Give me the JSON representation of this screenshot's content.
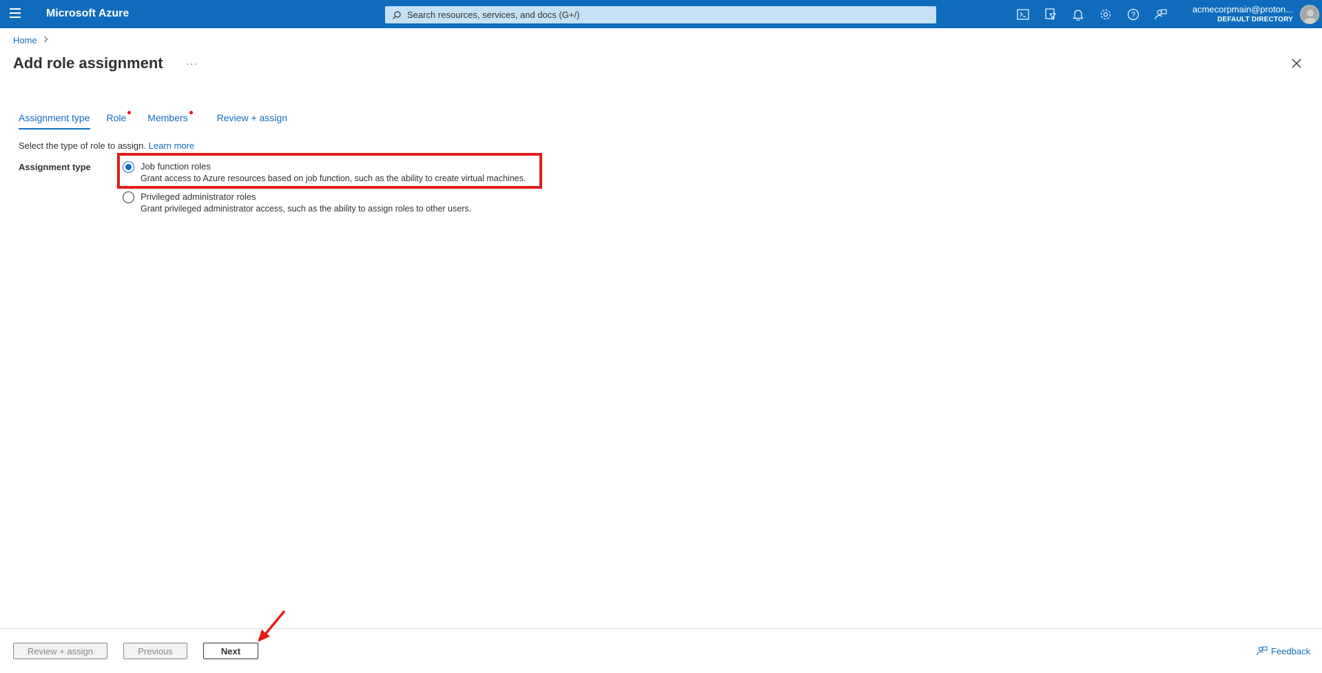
{
  "topbar": {
    "brand": "Microsoft Azure",
    "search_placeholder": "Search resources, services, and docs (G+/)",
    "icons": [
      "cloud-shell-icon",
      "directory-filter-icon",
      "notifications-icon",
      "settings-icon",
      "help-icon",
      "feedback-icon"
    ],
    "account_name": "acmecorpmain@proton...",
    "account_directory": "DEFAULT DIRECTORY",
    "bar_color": "#0f6cbd"
  },
  "breadcrumb": {
    "home": "Home"
  },
  "page": {
    "title": "Add role assignment",
    "more": "···"
  },
  "tabs": [
    {
      "label": "Assignment type",
      "active": true,
      "required": false
    },
    {
      "label": "Role",
      "active": false,
      "required": true
    },
    {
      "label": "Members",
      "active": false,
      "required": true
    },
    {
      "label": "Review + assign",
      "active": false,
      "required": false
    }
  ],
  "description": {
    "text": "Select the type of role to assign.",
    "link": "Learn more"
  },
  "assignment_type": {
    "label": "Assignment type",
    "options": [
      {
        "title": "Job function roles",
        "subtitle": "Grant access to Azure resources based on job function, such as the ability to create virtual machines.",
        "selected": true
      },
      {
        "title": "Privileged administrator roles",
        "subtitle": "Grant privileged administrator access, such as the ability to assign roles to other users.",
        "selected": false
      }
    ]
  },
  "footer": {
    "review_assign": "Review + assign",
    "previous": "Previous",
    "next": "Next",
    "feedback": "Feedback"
  },
  "annotation_color": "#e31b1b"
}
